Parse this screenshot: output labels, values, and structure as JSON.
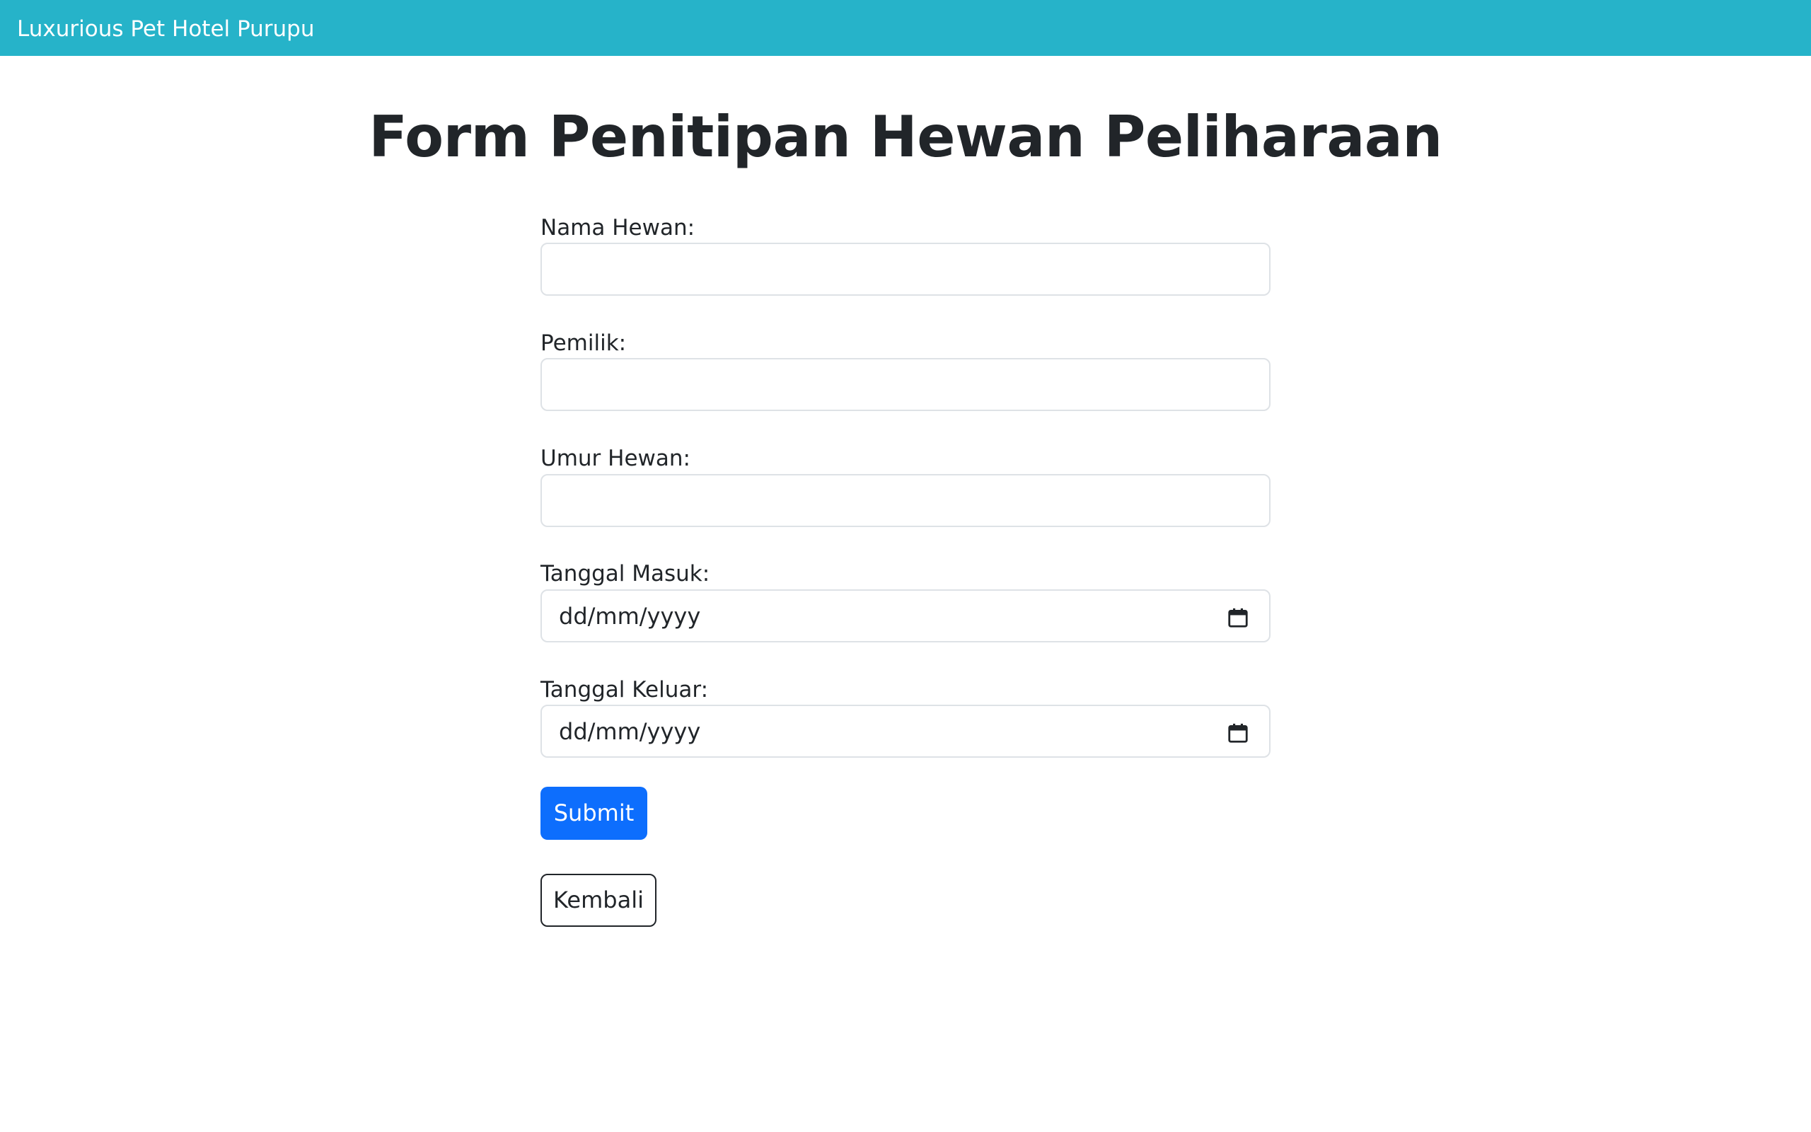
{
  "navbar": {
    "brand": "Luxurious Pet Hotel Purupu",
    "background_color": "#26b3c9"
  },
  "page": {
    "title": "Form Penitipan Hewan Peliharaan"
  },
  "form": {
    "fields": [
      {
        "label": "Nama Hewan:",
        "value": "",
        "type": "text"
      },
      {
        "label": "Pemilik:",
        "value": "",
        "type": "text"
      },
      {
        "label": "Umur Hewan:",
        "value": "",
        "type": "text"
      },
      {
        "label": "Tanggal Masuk:",
        "value": "dd/mm/yyyy",
        "type": "date",
        "icon": "calendar-icon"
      },
      {
        "label": "Tanggal Keluar:",
        "value": "dd/mm/yyyy",
        "type": "date",
        "icon": "calendar-icon"
      }
    ],
    "submit_label": "Submit",
    "submit_color": "#0d6efd",
    "back_label": "Kembali"
  }
}
